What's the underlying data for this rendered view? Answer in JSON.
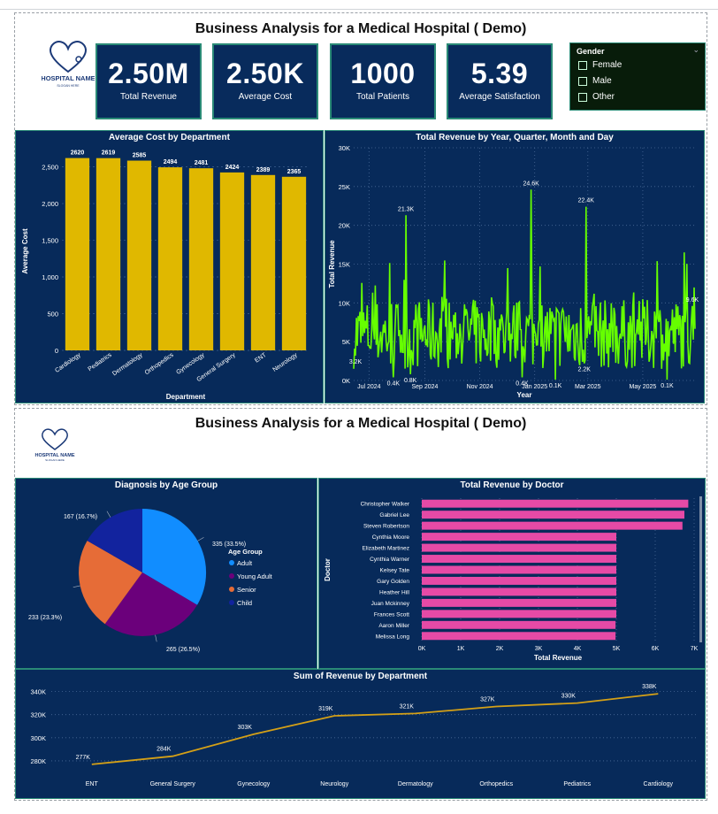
{
  "page1": {
    "title": "Business Analysis for a Medical Hospital ( Demo)",
    "logo_text": "HOSPITAL NAME",
    "logo_tagline": "SLOGAN HERE",
    "kpis": [
      {
        "value": "2.50M",
        "label": "Total Revenue"
      },
      {
        "value": "2.50K",
        "label": "Average Cost"
      },
      {
        "value": "1000",
        "label": "Total Patients"
      },
      {
        "value": "5.39",
        "label": "Average Satisfaction"
      }
    ],
    "slicer": {
      "title": "Gender",
      "options": [
        "Female",
        "Male",
        "Other"
      ]
    }
  },
  "page2": {
    "title": "Business Analysis for a Medical Hospital ( Demo)",
    "logo_text": "HOSPITAL NAME",
    "logo_tagline": "SLOGAN HERE"
  },
  "colors": {
    "panel": "#072a5a",
    "border": "#2a8a76",
    "bar_yellow": "#e0b800",
    "line_green": "#66ff00",
    "bar_pink": "#e64aa6",
    "line_gold": "#d4a017"
  },
  "chart_data": [
    {
      "id": "avg_cost",
      "type": "bar",
      "title": "Average Cost by Department",
      "xlabel": "Department",
      "ylabel": "Average Cost",
      "categories": [
        "Cardiology",
        "Pediatrics",
        "Dermatology",
        "Orthopedics",
        "Gynecology",
        "General Surgery",
        "ENT",
        "Neurology"
      ],
      "values": [
        2620,
        2619,
        2585,
        2494,
        2481,
        2424,
        2389,
        2365
      ],
      "ylim": [
        0,
        2700
      ],
      "yticks": [
        "0",
        "500",
        "1,000",
        "1,500",
        "2,000",
        "2,500"
      ],
      "color": "#e0b800"
    },
    {
      "id": "rev_time",
      "type": "line",
      "title": "Total Revenue by Year, Quarter, Month and Day",
      "xlabel": "Year",
      "ylabel": "Total Revenue",
      "ylim": [
        0,
        30000
      ],
      "yticks": [
        "0K",
        "5K",
        "10K",
        "15K",
        "20K",
        "25K",
        "30K"
      ],
      "xticks": [
        "Jul 2024",
        "Sep 2024",
        "Nov 2024",
        "Jan 2025",
        "Mar 2025",
        "May 2025"
      ],
      "x_range": [
        "2024-06-14",
        "2025-06-28"
      ],
      "annotations": [
        {
          "x": "2024-06-16",
          "y": 3200,
          "label": "3.2K"
        },
        {
          "x": "2024-08-11",
          "y": 21300,
          "label": "21.3K"
        },
        {
          "x": "2024-07-28",
          "y": 400,
          "label": "0.4K"
        },
        {
          "x": "2024-08-16",
          "y": 800,
          "label": "0.8K"
        },
        {
          "x": "2024-12-28",
          "y": 24600,
          "label": "24.6K"
        },
        {
          "x": "2024-12-18",
          "y": 400,
          "label": "0.4K"
        },
        {
          "x": "2025-01-24",
          "y": 100,
          "label": "0.1K"
        },
        {
          "x": "2025-02-27",
          "y": 22400,
          "label": "22.4K"
        },
        {
          "x": "2025-02-25",
          "y": 2200,
          "label": "2.2K"
        },
        {
          "x": "2025-05-28",
          "y": 100,
          "label": "0.1K"
        },
        {
          "x": "2025-06-25",
          "y": 9600,
          "label": "9.6K"
        }
      ]
    },
    {
      "id": "diag_age",
      "type": "pie",
      "title": "Diagnosis by Age Group",
      "legend_title": "Age Group",
      "slices": [
        {
          "name": "Adult",
          "value": 335,
          "label": "335 (33.5%)",
          "color": "#118dff"
        },
        {
          "name": "Young Adult",
          "value": 265,
          "label": "265 (26.5%)",
          "color": "#6b007b"
        },
        {
          "name": "Senior",
          "value": 233,
          "label": "233 (23.3%)",
          "color": "#e66c37"
        },
        {
          "name": "Child",
          "value": 167,
          "label": "167 (16.7%)",
          "color": "#12239e"
        }
      ]
    },
    {
      "id": "rev_doctor",
      "type": "bar",
      "orientation": "horizontal",
      "title": "Total Revenue by Doctor",
      "xlabel": "Total Revenue",
      "ylabel": "Doctor",
      "categories": [
        "Christopher Walker",
        "Gabriel Lee",
        "Steven Robertson",
        "Cynthia Moore",
        "Elizabeth Martinez",
        "Cynthia Warner",
        "Kelsey Tate",
        "Gary Golden",
        "Heather Hill",
        "Juan Mckinney",
        "Frances Scott",
        "Aaron Miller",
        "Melissa Long"
      ],
      "values": [
        6850,
        6750,
        6700,
        5000,
        5000,
        5000,
        5000,
        5000,
        5000,
        5000,
        5000,
        4980,
        4980
      ],
      "xlim": [
        0,
        7000
      ],
      "xticks": [
        "0K",
        "1K",
        "2K",
        "3K",
        "4K",
        "5K",
        "6K",
        "7K"
      ],
      "color": "#e64aa6"
    },
    {
      "id": "rev_dept",
      "type": "line",
      "title": "Sum of Revenue by Department",
      "categories": [
        "ENT",
        "General Surgery",
        "Gynecology",
        "Neurology",
        "Dermatology",
        "Orthopedics",
        "Pediatrics",
        "Cardiology"
      ],
      "values": [
        277000,
        284000,
        303000,
        319000,
        321000,
        327000,
        330000,
        338000
      ],
      "labels": [
        "277K",
        "284K",
        "303K",
        "319K",
        "321K",
        "327K",
        "330K",
        "338K"
      ],
      "ylim": [
        270000,
        345000
      ],
      "yticks": [
        "280K",
        "300K",
        "320K",
        "340K"
      ],
      "color": "#d4a017"
    }
  ]
}
